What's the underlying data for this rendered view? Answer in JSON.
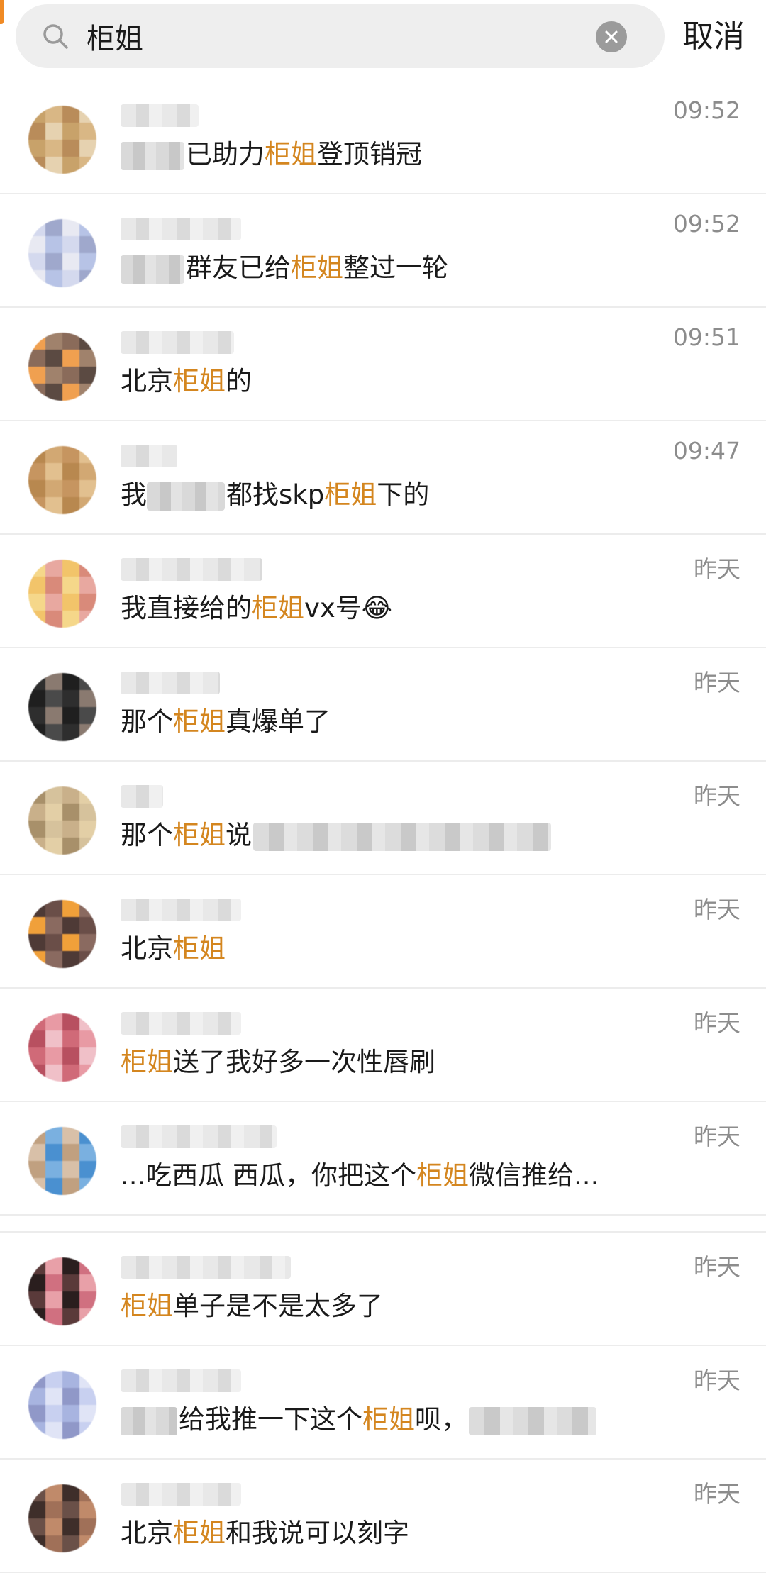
{
  "search": {
    "query": "柜姐",
    "cancel_label": "取消"
  },
  "keyword": "柜姐",
  "results": [
    {
      "time": "09:52",
      "before": "已助力",
      "after": "登顶销冠",
      "pre_blur": 90,
      "post_blur": 0,
      "name_blur": 110,
      "avatar": [
        "#c8a26a",
        "#d9b785",
        "#b98c5a",
        "#e6d2b0"
      ]
    },
    {
      "time": "09:52",
      "before": "群友已给",
      "after": "整过一轮",
      "pre_blur": 90,
      "post_blur": 0,
      "name_blur": 170,
      "avatar": [
        "#b7c3e6",
        "#d4d9ee",
        "#9fa8cc",
        "#e8e9f2"
      ]
    },
    {
      "time": "09:51",
      "before": "北京",
      "after": "的",
      "pre_blur": 0,
      "post_blur": 0,
      "name_blur": 160,
      "avatar": [
        "#8a6b5a",
        "#5b4a42",
        "#f0a050",
        "#a0826c"
      ]
    },
    {
      "time": "09:47",
      "before": "我",
      "after": "下的",
      "middle": "都找skp",
      "pre_blur": 0,
      "mid_blur": 110,
      "post_blur": 0,
      "name_blur": 80,
      "avatar": [
        "#d2a873",
        "#c69560",
        "#e2c08f",
        "#b8884f"
      ]
    },
    {
      "time": "昨天",
      "before": "我直接给的",
      "after": "vx号😂",
      "pre_blur": 0,
      "post_blur": 0,
      "name_blur": 200,
      "avatar": [
        "#f5d78a",
        "#e8a8a0",
        "#f2c46a",
        "#d98a7a"
      ]
    },
    {
      "time": "昨天",
      "before": "那个",
      "after": "真爆单了",
      "pre_blur": 0,
      "post_blur": 0,
      "name_blur": 140,
      "avatar": [
        "#4a4a4a",
        "#2e2e2e",
        "#8a7a70",
        "#1f1f1f"
      ]
    },
    {
      "time": "昨天",
      "before": "那个",
      "after": "说",
      "pre_blur": 0,
      "post_blur": 420,
      "name_blur": 60,
      "avatar": [
        "#c9b08a",
        "#e3cfa6",
        "#a8906a",
        "#d6c29c"
      ]
    },
    {
      "time": "昨天",
      "before": "北京",
      "after": "",
      "pre_blur": 0,
      "post_blur": 0,
      "name_blur": 170,
      "avatar": [
        "#6a4e48",
        "#f0a03a",
        "#8a6a60",
        "#4e3a36"
      ]
    },
    {
      "time": "昨天",
      "before": "",
      "after": "送了我好多一次性唇刷",
      "pre_blur": 0,
      "post_blur": 0,
      "name_blur": 170,
      "avatar": [
        "#d06a78",
        "#e89aa4",
        "#b85060",
        "#f0c0c8"
      ]
    },
    {
      "time": "昨天",
      "before": "...吃西瓜 西瓜，你把这个",
      "after": "微信推给...",
      "pre_blur": 0,
      "post_blur": 0,
      "name_blur": 220,
      "avatar": [
        "#4a90d0",
        "#c0a080",
        "#7ab0e0",
        "#d8c0a8"
      ]
    },
    {
      "time": "昨天",
      "before": "",
      "after": "单子是不是太多了",
      "pre_blur": 0,
      "post_blur": 0,
      "name_blur": 240,
      "avatar": [
        "#2a1e1e",
        "#d07080",
        "#5a3a3a",
        "#e8a0a8"
      ]
    },
    {
      "time": "昨天",
      "before": "给我推一下这个",
      "after": "呗，",
      "pre_blur": 80,
      "post_blur": 180,
      "name_blur": 170,
      "avatar": [
        "#c8d0f0",
        "#a8b4e0",
        "#e0e4f6",
        "#9098c8"
      ]
    },
    {
      "time": "昨天",
      "before": "北京",
      "after": "和我说可以刻字",
      "pre_blur": 0,
      "post_blur": 0,
      "name_blur": 170,
      "avatar": [
        "#6a5048",
        "#c08a6a",
        "#3e2e2a",
        "#a07058"
      ]
    }
  ]
}
